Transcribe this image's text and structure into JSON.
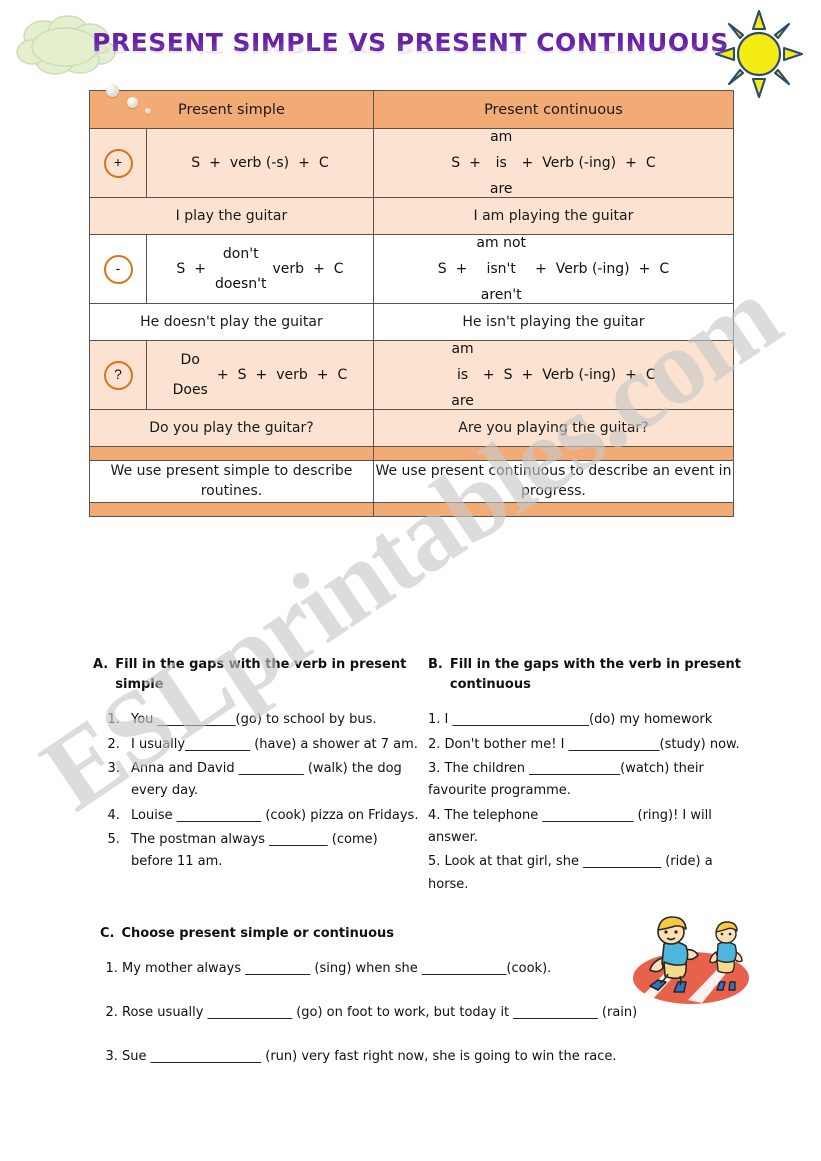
{
  "title": "PRESENT SIMPLE VS PRESENT CONTINUOUS",
  "watermark": "ESLprintables.com",
  "colors": {
    "title_purple": "#6621a8",
    "header_orange": "#f3ab76",
    "row_peach": "#fbe2d1",
    "circle_orange": "#d8741b",
    "sun_yellow": "#f5ec14",
    "sun_outline": "#2c4a72",
    "cloud_green": "#e2eecb",
    "track_red": "#e8614a"
  },
  "icons": {
    "cloud": "thought-cloud-icon",
    "sun": "sun-icon",
    "runners": "running-boys-icon"
  },
  "table": {
    "headers": {
      "simple": "Present simple",
      "continuous": "Present continuous"
    },
    "affirmative": {
      "symbol": "+",
      "simple": [
        "S",
        "+",
        "verb (-s)",
        "+",
        "C"
      ],
      "continuous_subject": "S",
      "continuous_aux": [
        "am",
        "is",
        "are"
      ],
      "continuous_rest": [
        "Verb (-ing)",
        "C"
      ],
      "example_simple": "I play the guitar",
      "example_continuous": "I am playing the guitar"
    },
    "negative": {
      "symbol": "-",
      "simple_subject": "S",
      "simple_aux": [
        "don't",
        "doesn't"
      ],
      "simple_rest": [
        "verb",
        "C"
      ],
      "continuous_subject": "S",
      "continuous_aux": [
        "am not",
        "isn't",
        "aren't"
      ],
      "continuous_rest": [
        "Verb (-ing)",
        "C"
      ],
      "example_simple": "He doesn't play the guitar",
      "example_continuous": "He isn't playing the guitar"
    },
    "question": {
      "symbol": "?",
      "simple_aux": [
        "Do",
        "Does"
      ],
      "simple_rest": [
        "S",
        "verb",
        "C"
      ],
      "continuous_aux": [
        "am",
        "is",
        "are"
      ],
      "continuous_rest": [
        "S",
        "Verb (-ing)",
        "C"
      ],
      "example_simple": "Do you play the guitar?",
      "example_continuous": "Are you playing the guitar?"
    },
    "summary": {
      "simple": "We use present simple to describe routines.",
      "continuous": "We use present continuous to describe an event in progress."
    }
  },
  "exercises": {
    "a": {
      "letter": "A.",
      "heading": "Fill in the gaps with the verb in present simple",
      "items": [
        "You ____________(go) to school by bus.",
        "I usually__________ (have) a shower at 7 am.",
        "Anna and David __________ (walk) the dog every day.",
        "Louise _____________ (cook) pizza on Fridays.",
        "The postman always _________ (come) before 11 am."
      ]
    },
    "b": {
      "letter": "B.",
      "heading": "Fill in the gaps with the verb in present continuous",
      "items": [
        "1. I _____________________(do) my homework",
        "2. Don't bother me! I ______________(study) now.",
        "3. The children ______________(watch) their favourite programme.",
        "4. The telephone ______________ (ring)! I will answer.",
        "5. Look at that girl, she ____________ (ride) a horse."
      ]
    },
    "c": {
      "letter": "C.",
      "heading": "Choose present simple or continuous",
      "items": [
        "My mother always __________ (sing) when she _____________(cook).",
        "Rose usually _____________ (go) on foot to work, but today it _____________ (rain)",
        "Sue _________________ (run) very fast right now, she is going to win the race."
      ]
    }
  }
}
